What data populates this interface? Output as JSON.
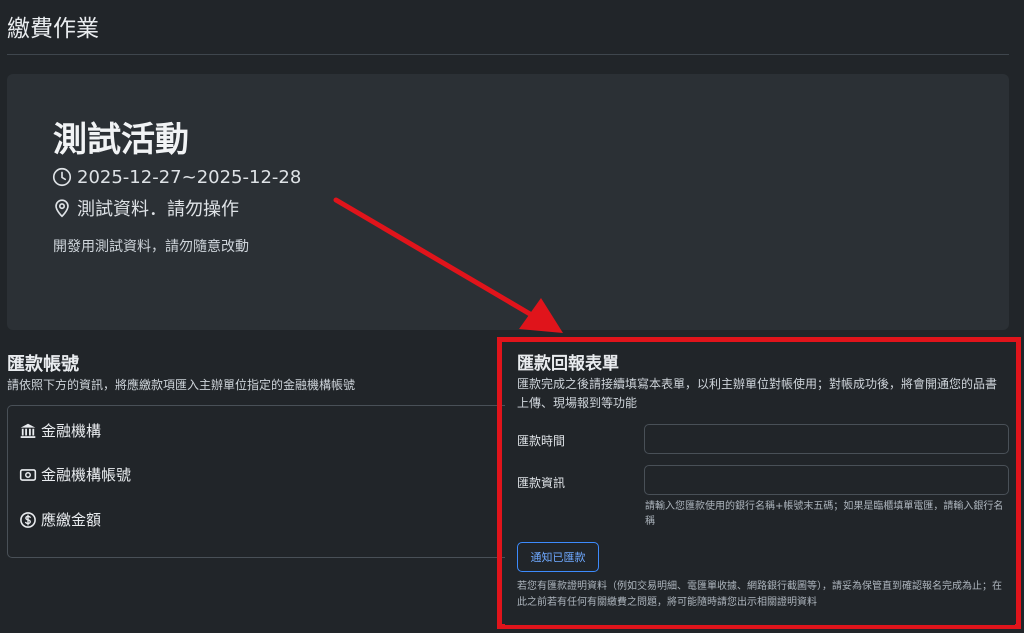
{
  "header": {
    "title": "繳費作業"
  },
  "event": {
    "title": "測試活動",
    "date_range": "2025-12-27~2025-12-28",
    "location": "測試資料．請勿操作",
    "description": "開發用測試資料，請勿隨意改動"
  },
  "account": {
    "title": "匯款帳號",
    "subtitle": "請依照下方的資訊，將應繳款項匯入主辦單位指定的金融機構帳號",
    "rows": [
      {
        "label": "金融機構",
        "icon": "bank-icon"
      },
      {
        "label": "金融機構帳號",
        "icon": "money-card-icon"
      },
      {
        "label": "應繳金額",
        "icon": "dollar-coin-icon"
      }
    ]
  },
  "form": {
    "title": "匯款回報表單",
    "description": "匯款完成之後請接續填寫本表單，以利主辦單位對帳使用；對帳成功後，將會開通您的品書上傳、現場報到等功能",
    "time_label": "匯款時間",
    "time_value": "",
    "info_label": "匯款資訊",
    "info_value": "",
    "info_help": "請輸入您匯款使用的銀行名稱+帳號末五碼；如果是臨櫃填單電匯，請輸入銀行名稱",
    "submit_label": "通知已匯款",
    "footer_note": "若您有匯款證明資料（例如交易明細、電匯單收據、網路銀行截圖等），請妥為保管直到確認報名完成為止；在此之前若有任何有關繳費之問題，將可能隨時請您出示相關證明資料"
  },
  "colors": {
    "background": "#212529",
    "card": "#2b3035",
    "highlight_frame": "#e0141b",
    "primary": "#3d8bfd"
  }
}
